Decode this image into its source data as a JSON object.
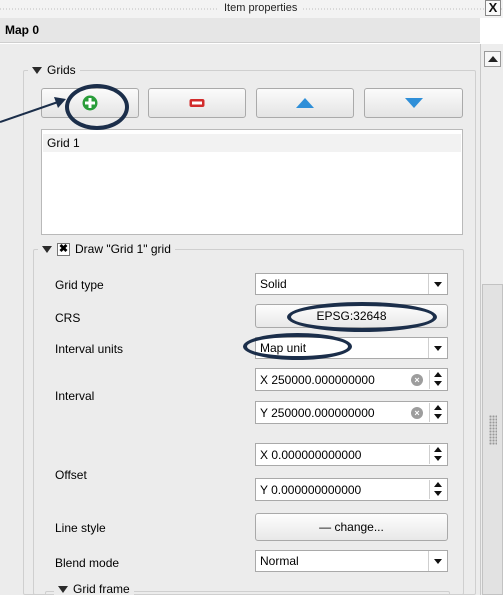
{
  "window": {
    "title": "Item properties",
    "close_glyph": "X"
  },
  "header": {
    "title": "Map 0"
  },
  "grids": {
    "section_label": "Grids",
    "buttons": [
      {
        "name": "add-grid-button",
        "icon": "plus-icon",
        "color": "#2a9d3a"
      },
      {
        "name": "remove-grid-button",
        "icon": "minus-icon",
        "color": "#d22b2b"
      },
      {
        "name": "move-up-button",
        "icon": "triangle-up-icon",
        "color": "#2f8fd8"
      },
      {
        "name": "move-down-button",
        "icon": "triangle-down-icon",
        "color": "#2f8fd8"
      }
    ],
    "list": [
      "Grid 1"
    ]
  },
  "draw_grid": {
    "checked": true,
    "check_glyph": "✖",
    "label": "Draw \"Grid 1\" grid",
    "grid_type_label": "Grid type",
    "grid_type_value": "Solid",
    "crs_label": "CRS",
    "crs_value": "EPSG:32648",
    "interval_units_label": "Interval units",
    "interval_units_value": "Map unit",
    "interval_label": "Interval",
    "interval_x": "X 250000.000000000",
    "interval_y": "Y 250000.000000000",
    "offset_label": "Offset",
    "offset_x": "X 0.000000000000",
    "offset_y": "Y 0.000000000000",
    "line_style_label": "Line style",
    "line_style_button": "— change...",
    "blend_mode_label": "Blend mode",
    "blend_mode_value": "Normal",
    "grid_frame_label": "Grid frame"
  },
  "colors": {
    "annotation": "#1b2e4a",
    "panel": "#ececec"
  }
}
